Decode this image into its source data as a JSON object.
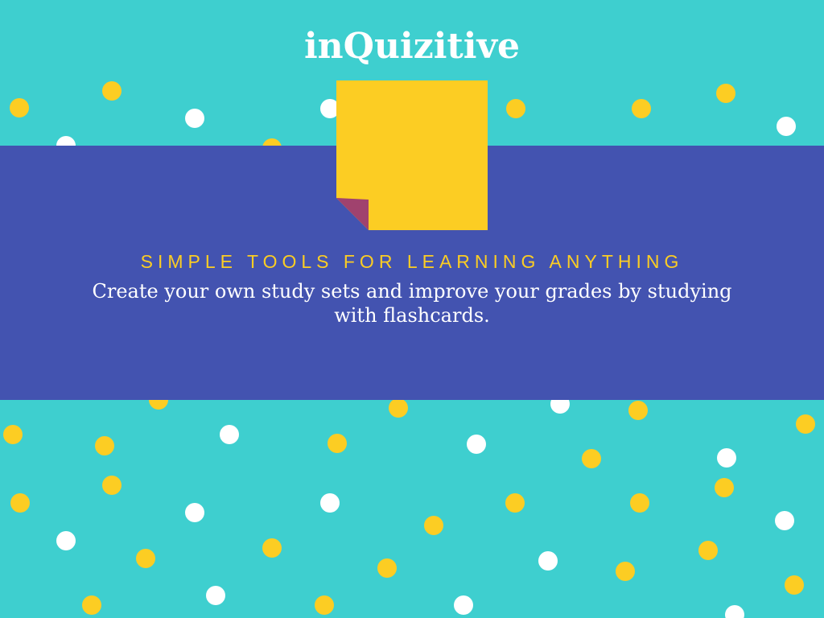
{
  "colors": {
    "background": "#3ecfcf",
    "band": "#4353b0",
    "accent_yellow": "#fccd23",
    "dot_white": "#ffffff",
    "fold": "#a0426e",
    "text_white": "#ffffff",
    "tagline": "#fccd23"
  },
  "icons": {
    "sticky_note": "sticky-note-icon"
  },
  "app": {
    "title": "inQuizitive"
  },
  "hero": {
    "tagline": "SIMPLE TOOLS FOR LEARNING ANYTHING",
    "description": "Create your own study sets and improve your grades by studying with flashcards."
  }
}
